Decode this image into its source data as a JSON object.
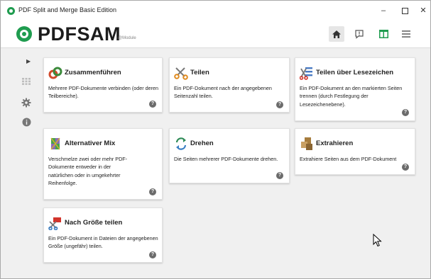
{
  "window": {
    "title": "PDF Split and Merge Basic Edition",
    "controls": {
      "minimize": "–",
      "maximize": "",
      "close": "✕"
    }
  },
  "header": {
    "logo_text": "PDFSAM",
    "logo_sub": "@Module",
    "buttons": [
      "home-icon",
      "news-icon",
      "dashboard-icon",
      "menu-icon"
    ]
  },
  "sidebar": {
    "items": [
      "modules-icon",
      "settings-icon",
      "info-icon"
    ]
  },
  "modules": [
    {
      "id": "merge",
      "title": "Zusammenführen",
      "description": "Mehrere PDF-Dokumente verbinden (oder deren Teilbereiche).",
      "icon": "merge-icon"
    },
    {
      "id": "split",
      "title": "Teilen",
      "description": "Ein PDF-Dokument nach der angegebenen Seitenzahl teilen.",
      "icon": "split-icon"
    },
    {
      "id": "split-bookmarks",
      "title": "Teilen über Lesezeichen",
      "description": "Ein PDF-Dokument an den markierten Seiten trennen (durch Festlegung der Lesezeichenebene).",
      "icon": "split-bookmarks-icon"
    },
    {
      "id": "alternate-mix",
      "title": "Alternativer Mix",
      "description": "Verschmelze zwei oder mehr PDF-Dokumente entweder in der natürlichen oder in umgekehrter Reihenfolge.",
      "icon": "alternate-mix-icon"
    },
    {
      "id": "rotate",
      "title": "Drehen",
      "description": "Die Seiten mehrerer PDF-Dokumente drehen.",
      "icon": "rotate-icon"
    },
    {
      "id": "extract",
      "title": "Extrahieren",
      "description": "Extrahiere Seiten aus dem PDF-Dokument",
      "icon": "extract-icon"
    },
    {
      "id": "split-size",
      "title": "Nach Größe teilen",
      "description": "Ein PDF-Dokument in Dateien der angegebenen Größe (ungefähr) teilen.",
      "icon": "split-size-icon"
    }
  ],
  "help_glyph": "?",
  "colors": {
    "brand_green": "#1f9c4f",
    "background": "#f0f0f0",
    "card": "#ffffff"
  }
}
